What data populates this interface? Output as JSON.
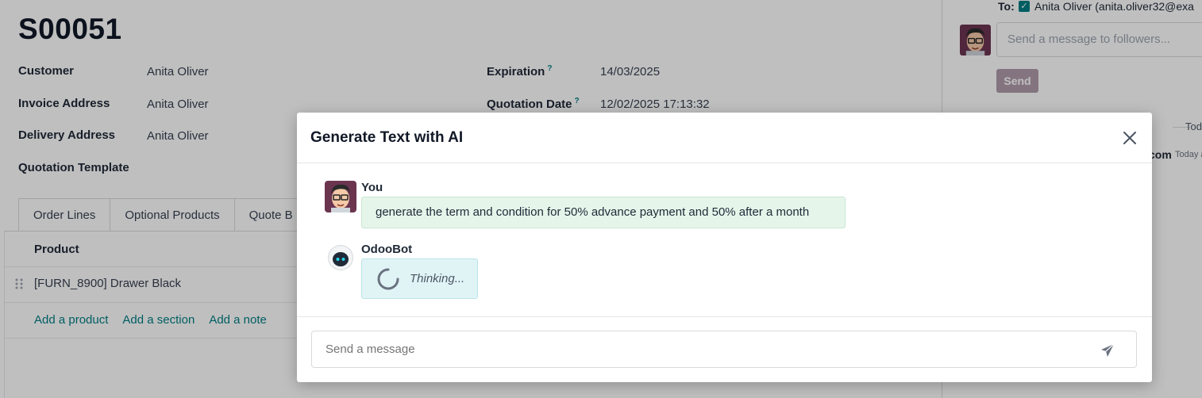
{
  "form": {
    "title": "S00051",
    "fields": {
      "customer_label": "Customer",
      "customer_value": "Anita Oliver",
      "invoice_label": "Invoice Address",
      "invoice_value": "Anita Oliver",
      "delivery_label": "Delivery Address",
      "delivery_value": "Anita Oliver",
      "template_label": "Quotation Template",
      "expiration_label": "Expiration",
      "expiration_value": "14/03/2025",
      "quotation_date_label": "Quotation Date",
      "quotation_date_value": "12/02/2025 17:13:32",
      "help_mark": "?"
    },
    "tabs": [
      "Order Lines",
      "Optional Products",
      "Quote B"
    ],
    "columns": {
      "product": "Product"
    },
    "lines": [
      {
        "product": "[FURN_8900] Drawer Black"
      }
    ],
    "add_links": [
      "Add a product",
      "Add a section",
      "Add a note"
    ]
  },
  "chatter": {
    "to_label": "To:",
    "recipient": "Anita Oliver (anita.oliver32@exa",
    "input_placeholder": "Send a message to followers...",
    "send_label": "Send",
    "separator_text": "Tod",
    "author_fragment": "com",
    "date_fragment": "Today a"
  },
  "modal": {
    "title": "Generate Text with AI",
    "messages": [
      {
        "author": "You",
        "text": "generate the term and condition for 50% advance payment and 50% after a month"
      },
      {
        "author": "OdooBot",
        "text": "Thinking..."
      }
    ],
    "composer_placeholder": "Send a message"
  },
  "colors": {
    "accent": "#017e84",
    "brand": "#714b67",
    "user_bubble": "#e6f5ea",
    "bot_bubble": "#e0f4f6"
  }
}
